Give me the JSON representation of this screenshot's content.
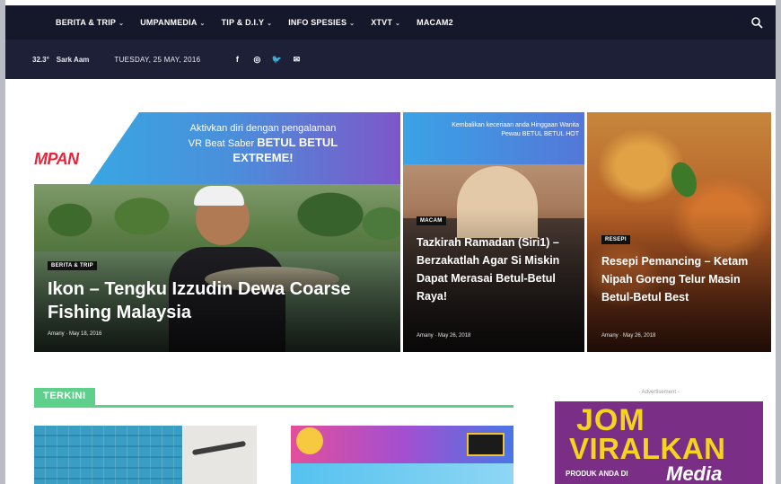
{
  "nav": {
    "items": [
      {
        "label": "BERITA & TRIP",
        "has_dropdown": true
      },
      {
        "label": "UMPANMEDIA",
        "has_dropdown": true
      },
      {
        "label": "TIP & D.I.Y",
        "has_dropdown": true
      },
      {
        "label": "INFO SPESIES",
        "has_dropdown": true
      },
      {
        "label": "XTVT",
        "has_dropdown": true
      },
      {
        "label": "MACAM2",
        "has_dropdown": false
      }
    ],
    "dropdown_glyph": "⌄",
    "search_icon": "search-icon"
  },
  "topbar": {
    "weather": "32.3°",
    "location": "Sark Aam",
    "date": "TUESDAY, 25 MAY, 2016",
    "social": [
      "f",
      "◎",
      "🐦",
      "✉"
    ],
    "social_icons": [
      "facebook-icon",
      "instagram-icon",
      "twitter-icon",
      "mail-icon"
    ]
  },
  "banner": {
    "logo": "MPAN",
    "line1": "Aktivkan diri dengan pengalaman",
    "line2": "VR Beat Saber",
    "line2_bold": "BETUL BETUL",
    "line3": "EXTREME!"
  },
  "featured": [
    {
      "category": "BERITA & TRIP",
      "title": "Ikon – Tengku Izzudin Dewa Coarse Fishing Malaysia",
      "meta": "Amany  ·  May 18, 2016"
    },
    {
      "strip_text": "Kembalikan keceriaan anda Hinggaan Wanita Pewau BETUL BETUL HOT",
      "category": "MACAM",
      "title": "Tazkirah Ramadan (Siri1) – Berzakatlah Agar Si Miskin Dapat Merasai Betul-Betul Raya!",
      "meta": "Amany  ·  May 26, 2018"
    },
    {
      "category": "RESEPI",
      "title": "Resepi Pemancing – Ketam Nipah Goreng Telur Masin Betul-Betul Best",
      "meta": "Amany  ·  May 26, 2018"
    }
  ],
  "latest": {
    "title": "TERKINI"
  },
  "ad": {
    "label": "- Advertisement -",
    "line1": "JOM",
    "line2": "VIRALKAN",
    "line3": "PRODUK ANDA DI",
    "line4": "Media"
  },
  "colors": {
    "nav_bg": "#15182a",
    "subbar_bg": "#1d2036",
    "accent_green": "#5ed08c",
    "logo_red": "#e8243a",
    "ad_purple": "#7a2e86",
    "ad_yellow": "#f6d31f"
  }
}
